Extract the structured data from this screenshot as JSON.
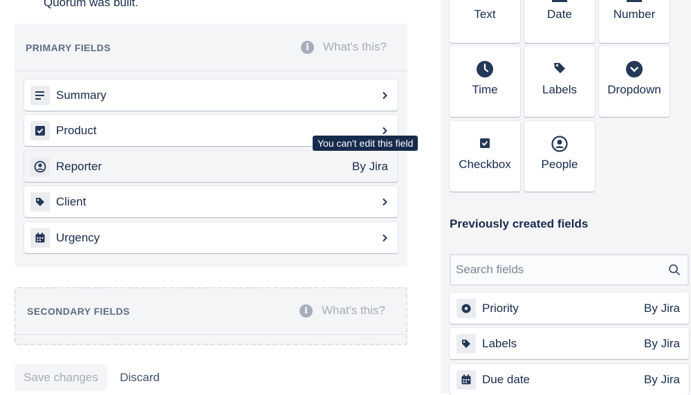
{
  "intro_text": "Quorum was built.",
  "primary": {
    "title": "PRIMARY FIELDS",
    "help": "What's this?",
    "fields": [
      {
        "label": "Summary",
        "icon": "text-lines-icon"
      },
      {
        "label": "Product",
        "icon": "checkbox-icon"
      },
      {
        "label": "Reporter",
        "icon": "person-icon",
        "right": "By Jira"
      },
      {
        "label": "Client",
        "icon": "tag-icon"
      },
      {
        "label": "Urgency",
        "icon": "calendar-icon"
      }
    ],
    "tooltip": "You can't edit this field"
  },
  "secondary": {
    "title": "SECONDARY FIELDS",
    "help": "What's this?"
  },
  "actions": {
    "save": "Save changes",
    "discard": "Discard"
  },
  "field_types": [
    {
      "label": "Text"
    },
    {
      "label": "Date"
    },
    {
      "label": "Number"
    },
    {
      "label": "Time",
      "icon": "clock-icon"
    },
    {
      "label": "Labels",
      "icon": "tag-icon"
    },
    {
      "label": "Dropdown",
      "icon": "chevron-circle-icon"
    },
    {
      "label": "Checkbox",
      "icon": "checkbox-icon"
    },
    {
      "label": "People",
      "icon": "person-icon"
    }
  ],
  "previous": {
    "title": "Previously created fields",
    "search_placeholder": "Search fields",
    "fields": [
      {
        "label": "Priority",
        "right": "By Jira",
        "icon": "radio-icon"
      },
      {
        "label": "Labels",
        "right": "By Jira",
        "icon": "tag-icon"
      },
      {
        "label": "Due date",
        "right": "By Jira",
        "icon": "calendar-icon"
      }
    ]
  },
  "colors": {
    "text": "#172B4D",
    "muted": "#A5ADBA",
    "panel": "#F4F5F7"
  }
}
